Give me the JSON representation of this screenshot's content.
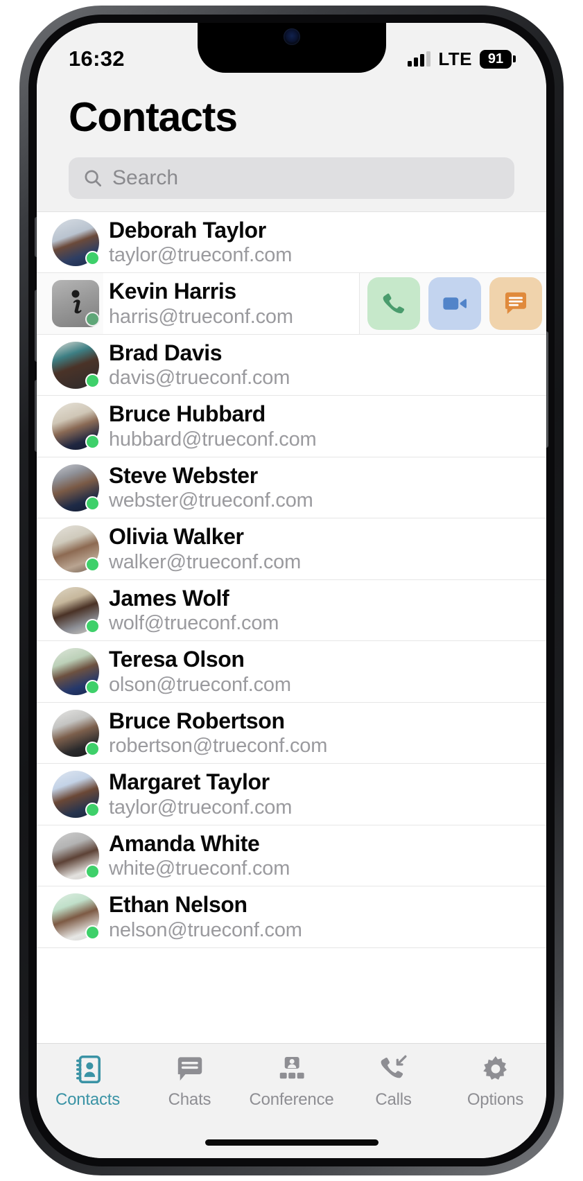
{
  "statusbar": {
    "time": "16:32",
    "carrier": "LTE",
    "battery": "91",
    "signal_icon": "signal-bars-icon",
    "battery_icon": "battery-icon"
  },
  "header": {
    "title": "Contacts"
  },
  "search": {
    "placeholder": "Search",
    "value": "",
    "icon": "search-icon"
  },
  "swipe_actions": {
    "call": {
      "label": "Call",
      "icon": "phone-icon",
      "bg": "#c6e8ca",
      "fg": "#4a9c6d"
    },
    "video": {
      "label": "Video call",
      "icon": "video-camera-icon",
      "bg": "#c3d4ef",
      "fg": "#5284c9"
    },
    "chat": {
      "label": "Chat",
      "icon": "chat-bubble-icon",
      "bg": "#f0d3ac",
      "fg": "#e08a3c"
    }
  },
  "contacts": [
    {
      "name": "Deborah Taylor",
      "email": "taylor@trueconf.com",
      "status": "online",
      "avatar": "photo-woman-headset",
      "swiped": false
    },
    {
      "name": "Kevin Harris",
      "email": "harris@trueconf.com",
      "status": "online",
      "avatar": "photo-man-placeholder",
      "swiped": true
    },
    {
      "name": "Brad Davis",
      "email": "davis@trueconf.com",
      "status": "online",
      "avatar": "photo-man-office",
      "swiped": false
    },
    {
      "name": "Bruce Hubbard",
      "email": "hubbard@trueconf.com",
      "status": "online",
      "avatar": "photo-man-suit",
      "swiped": false
    },
    {
      "name": "Steve Webster",
      "email": "webster@trueconf.com",
      "status": "online",
      "avatar": "photo-man-glasses",
      "swiped": false
    },
    {
      "name": "Olivia Walker",
      "email": "walker@trueconf.com",
      "status": "online",
      "avatar": "photo-woman-window",
      "swiped": false
    },
    {
      "name": "James Wolf",
      "email": "wolf@trueconf.com",
      "status": "online",
      "avatar": "photo-man-tie",
      "swiped": false
    },
    {
      "name": "Teresa Olson",
      "email": "olson@trueconf.com",
      "status": "online",
      "avatar": "photo-woman-blazer",
      "swiped": false
    },
    {
      "name": "Bruce Robertson",
      "email": "robertson@trueconf.com",
      "status": "online",
      "avatar": "photo-man-headphones",
      "swiped": false
    },
    {
      "name": "Margaret Taylor",
      "email": "taylor@trueconf.com",
      "status": "online",
      "avatar": "photo-woman-smiling",
      "swiped": false
    },
    {
      "name": "Amanda White",
      "email": "white@trueconf.com",
      "status": "online",
      "avatar": "photo-woman-grey",
      "swiped": false
    },
    {
      "name": "Ethan Nelson",
      "email": "nelson@trueconf.com",
      "status": "online",
      "avatar": "photo-man-blinds",
      "swiped": false
    }
  ],
  "tabbar": {
    "active": "Contacts",
    "active_color": "#3a93a5",
    "inactive_color": "#8e8e93",
    "items": [
      {
        "label": "Contacts",
        "icon": "address-book-icon",
        "active": true
      },
      {
        "label": "Chats",
        "icon": "chat-bubble-icon",
        "active": false
      },
      {
        "label": "Conference",
        "icon": "conference-icon",
        "active": false
      },
      {
        "label": "Calls",
        "icon": "call-arrow-icon",
        "active": false
      },
      {
        "label": "Options",
        "icon": "gear-icon",
        "active": false
      }
    ]
  }
}
